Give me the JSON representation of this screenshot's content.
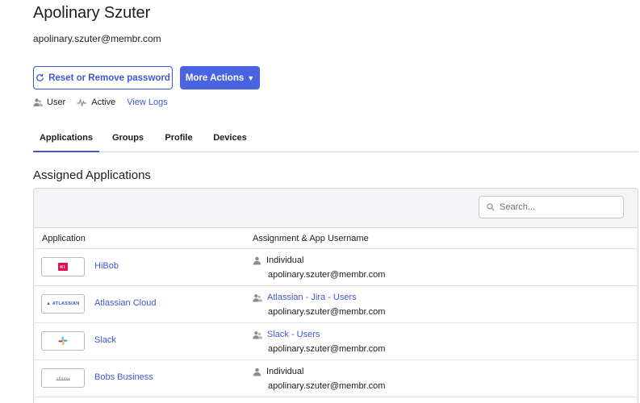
{
  "user": {
    "name": "Apolinary Szuter",
    "email": "apolinary.szuter@membr.com"
  },
  "actions": {
    "reset_label": "Reset or Remove password",
    "more_label": "More Actions",
    "more_caret": "▼"
  },
  "meta": {
    "role": "User",
    "status": "Active",
    "logs_link": "View Logs"
  },
  "tabs": [
    {
      "label": "Applications",
      "active": true
    },
    {
      "label": "Groups",
      "active": false
    },
    {
      "label": "Profile",
      "active": false
    },
    {
      "label": "Devices",
      "active": false
    }
  ],
  "section": {
    "title": "Assigned Applications"
  },
  "search": {
    "placeholder": "Search..."
  },
  "table": {
    "columns": [
      "Application",
      "Assignment & App Username"
    ],
    "rows": [
      {
        "app": "HiBob",
        "logo": "hibob-logo",
        "assignment": "Individual",
        "assignment_type": "individual",
        "username": "apolinary.szuter@membr.com"
      },
      {
        "app": "Atlassian Cloud",
        "logo": "atlassian-logo",
        "logo_text": "▲ ATLASSIAN",
        "assignment": "Atlassian - Jira - Users",
        "assignment_type": "group",
        "username": "apolinary.szuter@membr.com"
      },
      {
        "app": "Slack",
        "logo": "slack-logo",
        "assignment": "Slack - Users",
        "assignment_type": "group",
        "username": "apolinary.szuter@membr.com"
      },
      {
        "app": "Bobs Business",
        "logo": "bobs-business-logo",
        "assignment": "Individual",
        "assignment_type": "individual",
        "username": "apolinary.szuter@membr.com"
      }
    ]
  },
  "colors": {
    "accent": "#3e58d6",
    "primary_button": "#4a63e0",
    "hibob": "#e0114f"
  }
}
